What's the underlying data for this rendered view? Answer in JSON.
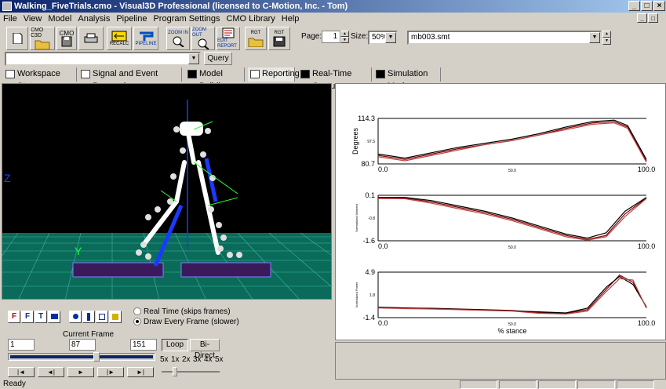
{
  "window": {
    "title": "Walking_FiveTrials.cmo - Visual3D Professional (licensed to C-Motion, Inc. - Tom)"
  },
  "menu": [
    "File",
    "View",
    "Model",
    "Analysis",
    "Pipeline",
    "Program Settings",
    "CMO Library",
    "Help"
  ],
  "toolbar": {
    "buttons": [
      {
        "label": ""
      },
      {
        "label": "CMO C3D"
      },
      {
        "label": "CMO"
      },
      {
        "label": ""
      },
      {
        "label": "RECALC"
      },
      {
        "label": "PIPELINE"
      },
      {
        "label": "ZOOM IN"
      },
      {
        "label": "ZOOM OUT"
      },
      {
        "label": "EDIT REPORT"
      },
      {
        "label": "RGT"
      },
      {
        "label": "RGT"
      },
      {
        "label": ""
      }
    ],
    "page_label": "Page:",
    "page_value": "1",
    "size_label": "Size:",
    "size_value": "50%",
    "report_file": "mb003.smt",
    "query_label": "Query"
  },
  "tabs": [
    "Workspace Status",
    "Signal and Event Processing",
    "Model Building",
    "Reporting",
    "Real-Time Capture",
    "Simulation Mode"
  ],
  "controls": {
    "playback_buttons": [
      "F",
      "F",
      "T",
      "",
      ""
    ],
    "radio_realtime": "Real Time (skips frames)",
    "radio_every": "Draw Every Frame (slower)",
    "current_frame_label": "Current Frame",
    "start_frame": "1",
    "current_frame": "87",
    "end_frame": "151",
    "loop_label": "Loop",
    "bidirect_label": "Bi-Direct",
    "speeds": [
      "5x",
      "1x",
      "2x",
      "3x",
      "4x",
      "5x"
    ]
  },
  "status": "Ready",
  "chart_data": [
    {
      "type": "line",
      "ylabel": "Degrees",
      "xlabel": "",
      "ylim": [
        80.7,
        114.3
      ],
      "yticks": [
        "114.3",
        "97.5",
        "80.7"
      ],
      "xlim": [
        0,
        100
      ],
      "xticks": [
        "0.0",
        "50.0",
        "100.0"
      ],
      "series": [
        {
          "values": [
            [
              0,
              87
            ],
            [
              10,
              84
            ],
            [
              20,
              88
            ],
            [
              30,
              92
            ],
            [
              40,
              95
            ],
            [
              50,
              98
            ],
            [
              60,
              102
            ],
            [
              70,
              107
            ],
            [
              80,
              111
            ],
            [
              88,
              112
            ],
            [
              93,
              108
            ],
            [
              100,
              83
            ]
          ]
        },
        {
          "values": [
            [
              0,
              88
            ],
            [
              10,
              85
            ],
            [
              20,
              89
            ],
            [
              30,
              93
            ],
            [
              40,
              96
            ],
            [
              50,
              99
            ],
            [
              60,
              103
            ],
            [
              70,
              108
            ],
            [
              80,
              112
            ],
            [
              88,
              113
            ],
            [
              93,
              109
            ],
            [
              100,
              84
            ]
          ]
        },
        {
          "values": [
            [
              0,
              86
            ],
            [
              10,
              83
            ],
            [
              20,
              87
            ],
            [
              30,
              91
            ],
            [
              40,
              95
            ],
            [
              50,
              98
            ],
            [
              60,
              102
            ],
            [
              70,
              106
            ],
            [
              80,
              110
            ],
            [
              88,
              111
            ],
            [
              93,
              107
            ],
            [
              100,
              82
            ]
          ]
        }
      ]
    },
    {
      "type": "line",
      "ylabel": "Normalized Moment",
      "xlabel": "",
      "ylim": [
        -1.6,
        0.1
      ],
      "yticks": [
        "0.1",
        "-0.8",
        "-1.6"
      ],
      "xlim": [
        0,
        100
      ],
      "xticks": [
        "0.0",
        "50.0",
        "100.0"
      ],
      "series": [
        {
          "values": [
            [
              0,
              0.0
            ],
            [
              10,
              0.0
            ],
            [
              20,
              -0.15
            ],
            [
              30,
              -0.35
            ],
            [
              40,
              -0.55
            ],
            [
              50,
              -0.8
            ],
            [
              60,
              -1.1
            ],
            [
              70,
              -1.4
            ],
            [
              78,
              -1.55
            ],
            [
              85,
              -1.4
            ],
            [
              92,
              -0.6
            ],
            [
              100,
              0.0
            ]
          ]
        },
        {
          "values": [
            [
              0,
              0.02
            ],
            [
              10,
              0.02
            ],
            [
              20,
              -0.1
            ],
            [
              30,
              -0.3
            ],
            [
              40,
              -0.5
            ],
            [
              50,
              -0.75
            ],
            [
              60,
              -1.05
            ],
            [
              70,
              -1.35
            ],
            [
              78,
              -1.5
            ],
            [
              85,
              -1.3
            ],
            [
              92,
              -0.5
            ],
            [
              100,
              0.02
            ]
          ]
        },
        {
          "values": [
            [
              0,
              -0.02
            ],
            [
              10,
              -0.03
            ],
            [
              20,
              -0.2
            ],
            [
              30,
              -0.4
            ],
            [
              40,
              -0.6
            ],
            [
              50,
              -0.85
            ],
            [
              60,
              -1.15
            ],
            [
              70,
              -1.45
            ],
            [
              78,
              -1.58
            ],
            [
              85,
              -1.45
            ],
            [
              92,
              -0.7
            ],
            [
              100,
              -0.02
            ]
          ]
        }
      ]
    },
    {
      "type": "line",
      "ylabel": "Normalized Power",
      "xlabel": "% stance",
      "ylim": [
        -1.4,
        4.9
      ],
      "yticks": [
        "4.9",
        "1.8",
        "-1.4"
      ],
      "xlim": [
        0,
        100
      ],
      "xticks": [
        "0.0",
        "50.0",
        "100.0"
      ],
      "series": [
        {
          "values": [
            [
              0,
              0.0
            ],
            [
              10,
              -0.1
            ],
            [
              20,
              -0.1
            ],
            [
              30,
              -0.2
            ],
            [
              40,
              -0.3
            ],
            [
              50,
              -0.4
            ],
            [
              60,
              -0.7
            ],
            [
              70,
              -0.8
            ],
            [
              78,
              -0.3
            ],
            [
              85,
              2.5
            ],
            [
              90,
              4.5
            ],
            [
              95,
              3.5
            ],
            [
              100,
              0.0
            ]
          ]
        },
        {
          "values": [
            [
              0,
              0.05
            ],
            [
              10,
              -0.05
            ],
            [
              20,
              -0.15
            ],
            [
              30,
              -0.25
            ],
            [
              40,
              -0.35
            ],
            [
              50,
              -0.45
            ],
            [
              60,
              -0.6
            ],
            [
              70,
              -0.75
            ],
            [
              78,
              -0.1
            ],
            [
              85,
              2.8
            ],
            [
              90,
              4.3
            ],
            [
              95,
              3.2
            ],
            [
              100,
              0.1
            ]
          ]
        },
        {
          "values": [
            [
              0,
              -0.05
            ],
            [
              10,
              -0.15
            ],
            [
              20,
              -0.2
            ],
            [
              30,
              -0.3
            ],
            [
              40,
              -0.4
            ],
            [
              50,
              -0.5
            ],
            [
              60,
              -0.8
            ],
            [
              70,
              -0.9
            ],
            [
              78,
              -0.5
            ],
            [
              85,
              2.2
            ],
            [
              90,
              4.0
            ],
            [
              95,
              3.8
            ],
            [
              100,
              -0.1
            ]
          ]
        }
      ]
    }
  ]
}
